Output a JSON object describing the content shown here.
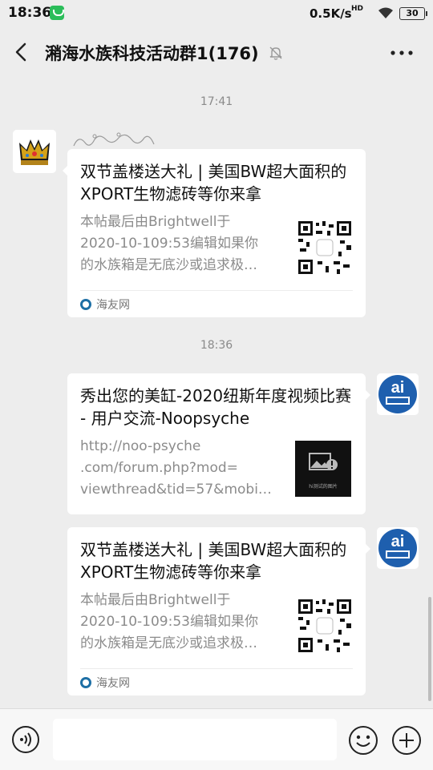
{
  "status_bar": {
    "time": "18:36",
    "network_speed": "0.5K/s",
    "network_label": "HD",
    "battery": "30"
  },
  "header": {
    "title": "潲海水族科技活动群1(176)"
  },
  "timestamps": [
    "17:41",
    "18:36"
  ],
  "messages": [
    {
      "title": "双节盖楼送大礼 | 美国BW超大面积的XPORT生物滤砖等你来拿",
      "description": "本帖最后由Brightwell于\n2020-10-109:53编辑如果你\n的水族箱是无底沙或追求极…",
      "source": "海友网"
    },
    {
      "title": "秀出您的美缸-2020纽斯年度视频比赛 - 用户交流-Noopsyche",
      "description": "http://noo-psyche\n.com/forum.php?mod=\nviewthread&tid=57&mobi…",
      "thumb_caption": "hi测试的图片"
    },
    {
      "title": "双节盖楼送大礼 | 美国BW超大面积的XPORT生物滤砖等你来拿",
      "description": "本帖最后由Brightwell于\n2020-10-109:53编辑如果你\n的水族箱是无底沙或追求极…",
      "source": "海友网"
    }
  ],
  "colors": {
    "background": "#ededed",
    "card": "#ffffff",
    "wechat_green": "#2bbd5a",
    "muted_text": "#8b8b8b"
  },
  "icons": [
    "back-icon",
    "mute-bell-icon",
    "more-icon",
    "voice-icon",
    "emoji-icon",
    "plus-icon"
  ]
}
